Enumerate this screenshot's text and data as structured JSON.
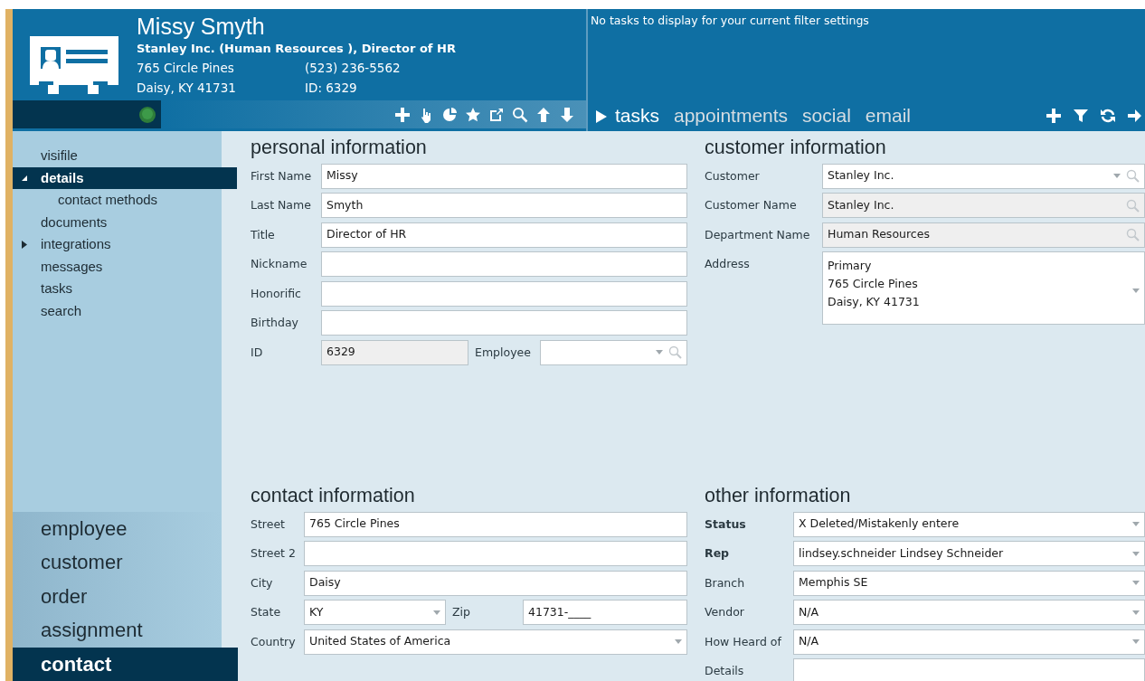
{
  "contact_card": {
    "name": "Missy Smyth",
    "subtitle": "Stanley Inc.  (Human Resources ), Director of HR",
    "lines": [
      [
        "765 Circle Pines",
        "(523) 236-5562"
      ],
      [
        "Daisy, KY   41731",
        "ID:  6329"
      ]
    ]
  },
  "tasks_panel": {
    "message": "No tasks to display for your current filter settings",
    "tabs": [
      {
        "label": "tasks",
        "selected": true
      },
      {
        "label": "appointments",
        "selected": false
      },
      {
        "label": "social",
        "selected": false
      },
      {
        "label": "email",
        "selected": false
      }
    ]
  },
  "sidebar": {
    "items": [
      {
        "label": "visifile",
        "selected": false
      },
      {
        "label": "details",
        "selected": true,
        "expanded": true,
        "children": [
          {
            "label": "contact methods",
            "selected": false
          }
        ]
      },
      {
        "label": "documents",
        "selected": false
      },
      {
        "label": "integrations",
        "selected": false,
        "expanded": false
      },
      {
        "label": "messages",
        "selected": false
      },
      {
        "label": "tasks",
        "selected": false
      },
      {
        "label": "search",
        "selected": false
      }
    ],
    "modules": [
      {
        "label": "employee",
        "selected": false
      },
      {
        "label": "customer",
        "selected": false
      },
      {
        "label": "order",
        "selected": false
      },
      {
        "label": "assignment",
        "selected": false
      },
      {
        "label": "contact",
        "selected": true
      }
    ]
  },
  "sections": [
    {
      "title": "personal information",
      "fields": [
        {
          "label": "First Name",
          "kind": "text",
          "value": "Missy"
        },
        {
          "label": "Last Name",
          "kind": "text",
          "value": "Smyth"
        },
        {
          "label": "Title",
          "kind": "text",
          "value": "Director of HR"
        },
        {
          "label": "Nickname",
          "kind": "text"
        },
        {
          "label": "Honorific",
          "kind": "text"
        },
        {
          "label": "Birthday",
          "kind": "text"
        },
        {
          "label": "ID",
          "kind": "readonly",
          "value": "6329",
          "beside": {
            "label": "Employee",
            "kind": "combo-lookup"
          }
        }
      ]
    },
    {
      "title": "customer information",
      "fields": [
        {
          "label": "Customer",
          "kind": "combo-lookup",
          "value": "Stanley Inc."
        },
        {
          "label": "Customer Name",
          "kind": "lookup",
          "value": "Stanley Inc."
        },
        {
          "label": "Department Name",
          "kind": "lookup",
          "value": "Human Resources"
        },
        {
          "label": "Address",
          "kind": "address",
          "lines": [
            "Primary",
            "765 Circle Pines",
            "Daisy, KY 41731"
          ]
        }
      ]
    },
    {
      "title": "contact information",
      "fields": [
        {
          "label": "Street",
          "kind": "text",
          "value": "765 Circle Pines"
        },
        {
          "label": "Street 2",
          "kind": "text"
        },
        {
          "label": "City",
          "kind": "text",
          "value": "Daisy"
        },
        {
          "label": "State",
          "kind": "combo",
          "value": "KY",
          "beside": {
            "label": "Zip",
            "kind": "text",
            "value": "41731-____"
          }
        },
        {
          "label": "Country",
          "kind": "combo",
          "value": "United States of America"
        }
      ]
    },
    {
      "title": "other information",
      "fields": [
        {
          "label": "Status",
          "kind": "combo",
          "value": "X  Deleted/Mistakenly entere",
          "required": true
        },
        {
          "label": "Rep",
          "kind": "combo",
          "value": "lindsey.schneider  Lindsey Schneider",
          "required": true
        },
        {
          "label": "Branch",
          "kind": "combo",
          "value": "Memphis SE",
          "required": false
        },
        {
          "label": "Vendor",
          "kind": "combo",
          "value": "N/A",
          "required": false
        },
        {
          "label": "How Heard of",
          "kind": "combo",
          "value": "N/A",
          "required": false
        },
        {
          "label": "Details",
          "kind": "textarea",
          "required": false
        }
      ]
    }
  ]
}
